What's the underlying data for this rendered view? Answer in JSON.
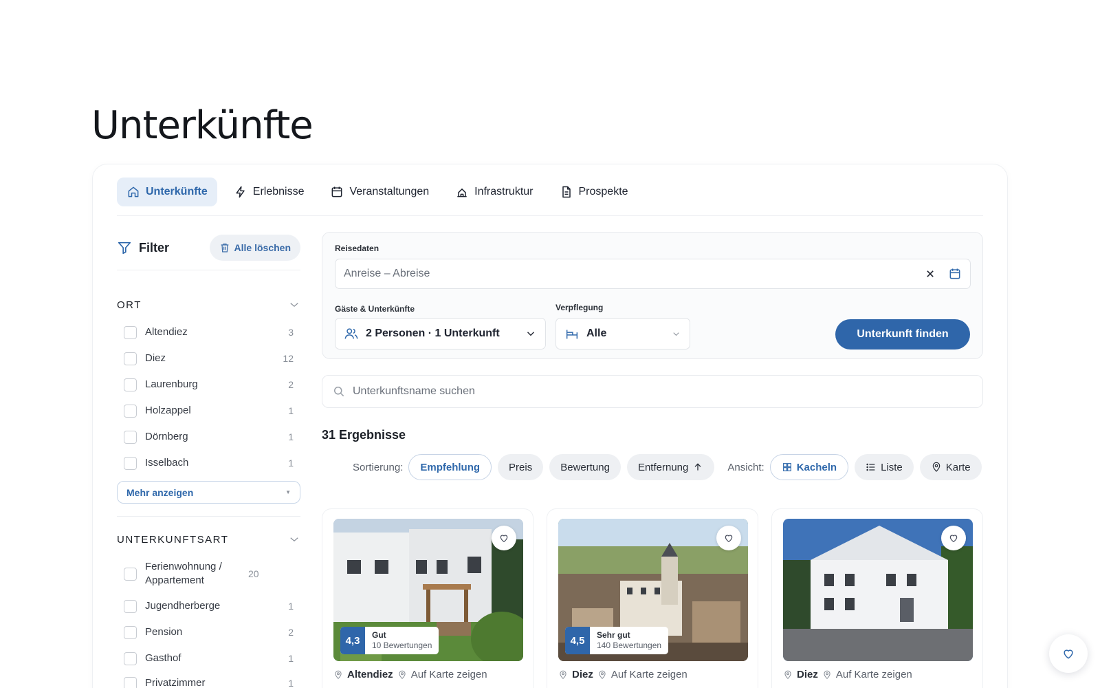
{
  "page": {
    "title": "Unterkünfte"
  },
  "tabs": [
    {
      "label": "Unterkünfte",
      "icon": "home-icon",
      "active": true
    },
    {
      "label": "Erlebnisse",
      "icon": "lightning-icon"
    },
    {
      "label": "Veranstaltungen",
      "icon": "calendar-icon"
    },
    {
      "label": "Infrastruktur",
      "icon": "building-icon"
    },
    {
      "label": "Prospekte",
      "icon": "document-icon"
    }
  ],
  "filter": {
    "title": "Filter",
    "clear_label": "Alle löschen",
    "groups": [
      {
        "title": "ORT",
        "items": [
          {
            "label": "Altendiez",
            "count": "3"
          },
          {
            "label": "Diez",
            "count": "12"
          },
          {
            "label": "Laurenburg",
            "count": "2"
          },
          {
            "label": "Holzappel",
            "count": "1"
          },
          {
            "label": "Dörnberg",
            "count": "1"
          },
          {
            "label": "Isselbach",
            "count": "1"
          }
        ],
        "more_label": "Mehr anzeigen"
      },
      {
        "title": "UNTERKUNFTSART",
        "items": [
          {
            "label": "Ferienwohnung / Appartement",
            "count": "20"
          },
          {
            "label": "Jugendherberge",
            "count": "1"
          },
          {
            "label": "Pension",
            "count": "2"
          },
          {
            "label": "Gasthof",
            "count": "1"
          },
          {
            "label": "Privatzimmer",
            "count": "1"
          }
        ]
      }
    ]
  },
  "search": {
    "dates_label": "Reisedaten",
    "dates_placeholder": "Anreise – Abreise",
    "guests_label": "Gäste & Unterkünfte",
    "guests_value": "2 Personen · 1 Unterkunft",
    "board_label": "Verpflegung",
    "board_value": "Alle",
    "submit_label": "Unterkunft finden",
    "name_placeholder": "Unterkunftsname suchen"
  },
  "results": {
    "count_label": "31 Ergebnisse",
    "sort_label": "Sortierung:",
    "sort_options": [
      "Empfehlung",
      "Preis",
      "Bewertung",
      "Entfernung"
    ],
    "sort_active": "Empfehlung",
    "view_label": "Ansicht:",
    "view_options": [
      "Kacheln",
      "Liste",
      "Karte"
    ],
    "view_active": "Kacheln"
  },
  "cards": [
    {
      "score": "4,3",
      "rating_word": "Gut",
      "reviews": "10 Bewertungen",
      "location": "Altendiez",
      "map_label": "Auf Karte zeigen"
    },
    {
      "score": "4,5",
      "rating_word": "Sehr gut",
      "reviews": "140 Bewertungen",
      "location": "Diez",
      "map_label": "Auf Karte zeigen"
    },
    {
      "location": "Diez",
      "map_label": "Auf Karte zeigen"
    }
  ],
  "colors": {
    "accent": "#2f66aa",
    "accent_light": "#e6eef8",
    "text": "#1b1f26",
    "muted": "#5a606a"
  }
}
